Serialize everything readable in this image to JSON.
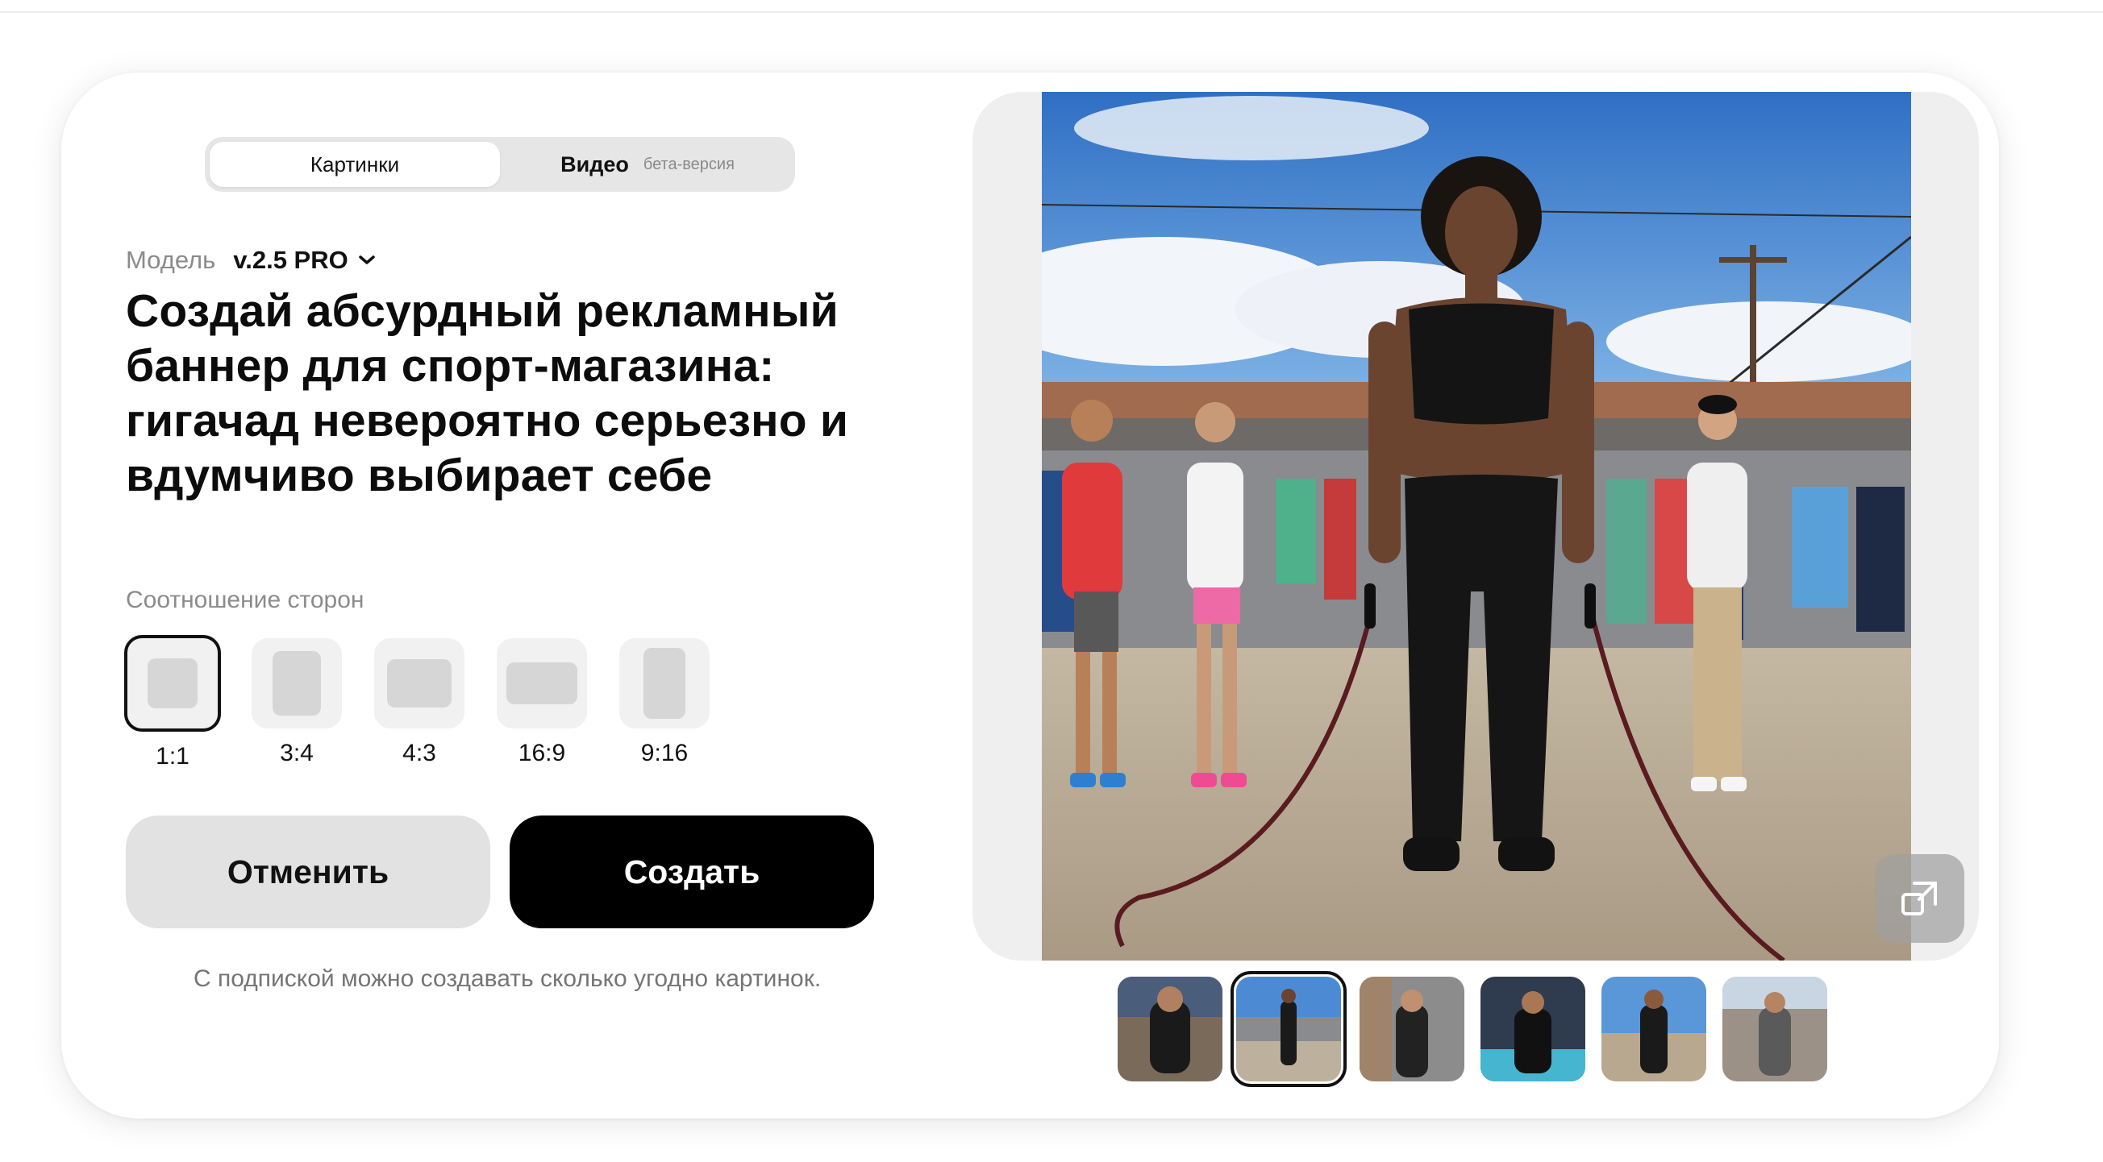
{
  "tabs": {
    "images_label": "Картинки",
    "video_label": "Видео",
    "beta_label": "бета-версия"
  },
  "model": {
    "label": "Модель",
    "value": "v.2.5 PRO"
  },
  "prompt_text": "Создай абсурдный рекламный баннер для спорт-магазина: гигачад невероятно серьезно и вдумчиво выбирает себе",
  "aspect": {
    "title": "Соотношение сторон",
    "options": [
      "1:1",
      "3:4",
      "4:3",
      "16:9",
      "9:16"
    ],
    "selected": "1:1"
  },
  "buttons": {
    "cancel": "Отменить",
    "create": "Создать"
  },
  "note": "С подпиской можно создавать сколько угодно картинок.",
  "preview": {
    "thumbnails_count": 6,
    "selected_thumbnail": 2
  },
  "colors": {
    "accent": "#000000",
    "sky": "#3f7fcf",
    "pavement": "#b7aa95"
  }
}
